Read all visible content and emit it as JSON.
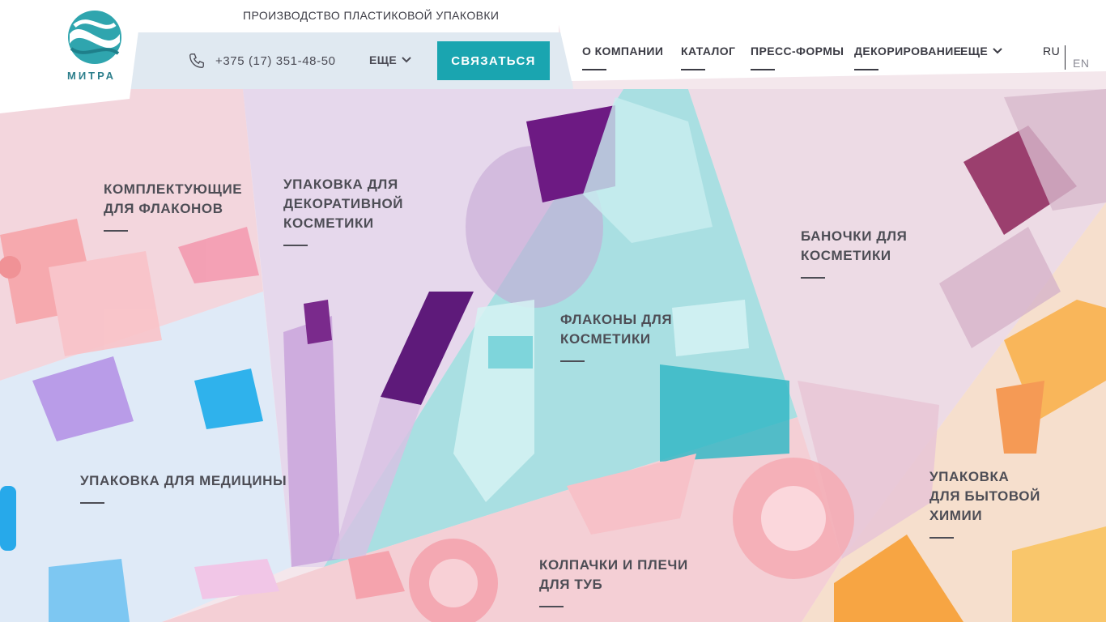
{
  "brand": {
    "logo_text": "МИТРА",
    "accent_color": "#1aa5b0"
  },
  "header": {
    "tagline": "ПРОИЗВОДСТВО ПЛАСТИКОВОЙ УПАКОВКИ",
    "phone": "+375 (17) 351-48-50",
    "more_label": "ЕЩЕ",
    "contact_label": "СВЯЗАТЬСЯ"
  },
  "nav": {
    "items": [
      "О КОМПАНИИ",
      "КАТАЛОГ",
      "ПРЕСС-ФОРМЫ",
      "ДЕКОРИРОВАНИЕ"
    ],
    "more_label": "ЕЩЕ",
    "languages": [
      "RU",
      "EN"
    ],
    "active_language": "RU"
  },
  "panels": [
    {
      "lines": [
        "КОМПЛЕКТУЮЩИЕ",
        "ДЛЯ ФЛАКОНОВ"
      ]
    },
    {
      "lines": [
        "УПАКОВКА ДЛЯ",
        "ДЕКОРАТИВНОЙ",
        "КОСМЕТИКИ"
      ]
    },
    {
      "lines": [
        "ФЛАКОНЫ ДЛЯ",
        "КОСМЕТИКИ"
      ]
    },
    {
      "lines": [
        "БАНОЧКИ ДЛЯ",
        "КОСМЕТИКИ"
      ]
    },
    {
      "lines": [
        "УПАКОВКА ДЛЯ МЕДИЦИНЫ"
      ]
    },
    {
      "lines": [
        "КОЛПАЧКИ И ПЛЕЧИ",
        "ДЛЯ ТУБ"
      ]
    },
    {
      "lines": [
        "УПАКОВКА",
        "ДЛЯ БЫТОВОЙ",
        "ХИМИИ"
      ]
    }
  ]
}
